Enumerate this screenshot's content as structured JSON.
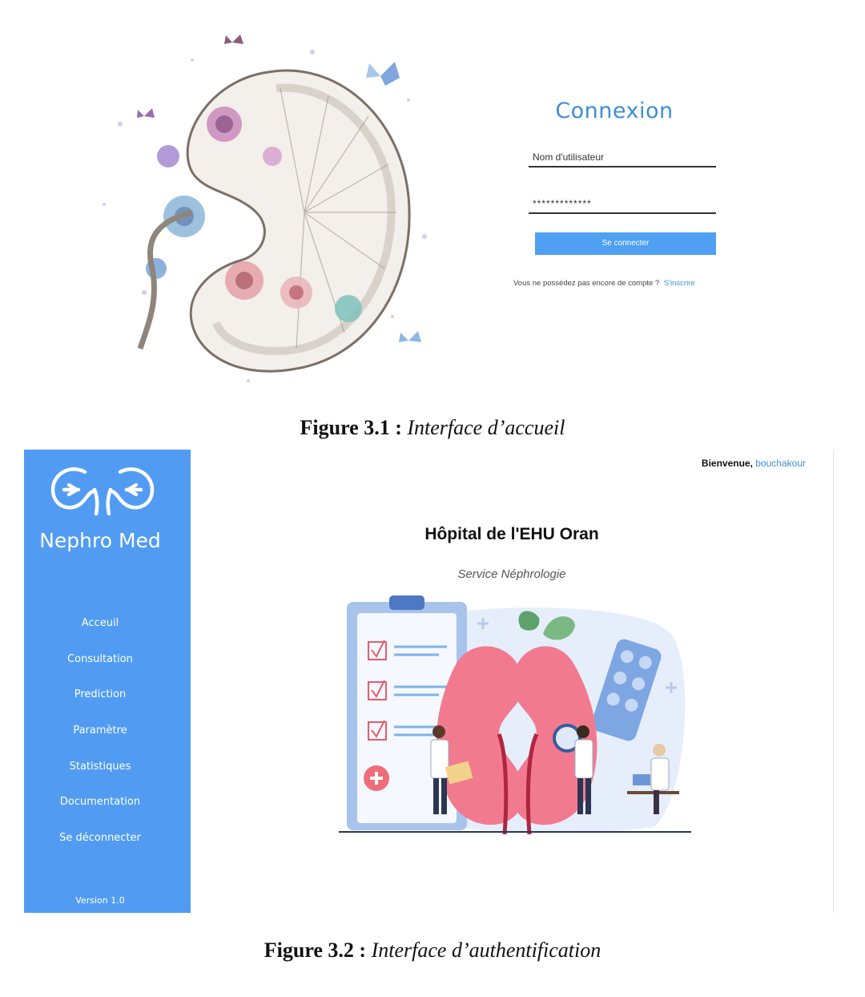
{
  "login": {
    "title": "Connexion",
    "username_label": "Nom d'utilisateur",
    "password_value": "*************",
    "submit_label": "Se connecter",
    "signup_prompt": "Vous ne possédez pas encore de compte ?",
    "signup_link": "S'inscrire"
  },
  "captions": {
    "figure1_number": "Figure 3.1 :",
    "figure1_title": "Interface d’accueil",
    "figure2_number": "Figure 3.2 :",
    "figure2_title": "Interface d’authentification"
  },
  "dashboard": {
    "app_name": "Nephro Med",
    "welcome_prefix": "Bienvenue,",
    "welcome_user": "bouchakour",
    "hospital_title": "Hôpital de l'EHU Oran",
    "service_subtitle": "Service Néphrologie",
    "nav": [
      "Acceuil",
      "Consultation",
      "Prediction",
      "Paramètre",
      "Statistiques",
      "Documentation",
      "Se déconnecter"
    ],
    "version": "Version 1.0"
  },
  "colors": {
    "sidebar_blue": "#519cf2",
    "accent_blue": "#3d8fd6",
    "button_blue": "#4f9ff2"
  },
  "icons": [
    "kidney-watercolor-art",
    "kidney-pair-logo-icon",
    "nephrology-illustration"
  ]
}
